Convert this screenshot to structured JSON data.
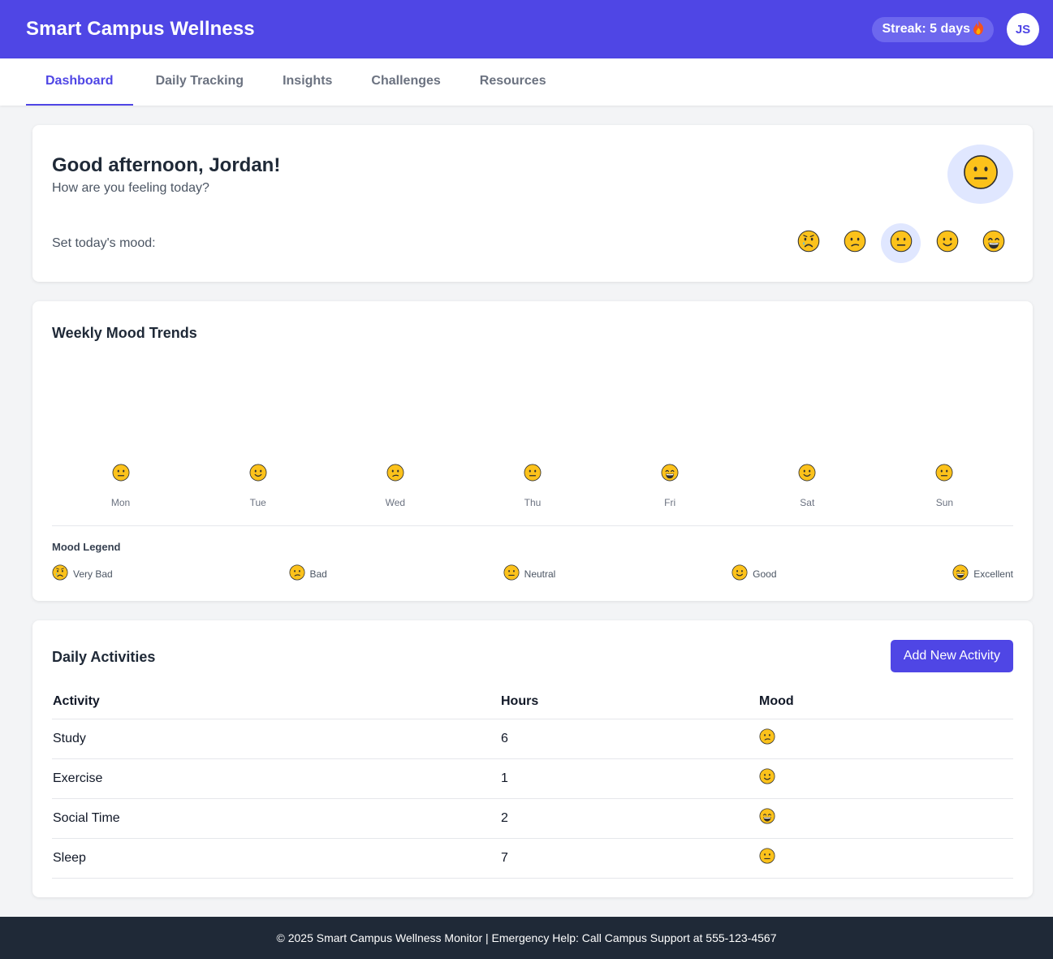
{
  "header": {
    "title": "Smart Campus Wellness",
    "streak_label": "Streak: 5 days",
    "streak_icon": "fire-icon",
    "avatar_initials": "JS"
  },
  "nav": {
    "tabs": [
      {
        "label": "Dashboard",
        "active": true
      },
      {
        "label": "Daily Tracking",
        "active": false
      },
      {
        "label": "Insights",
        "active": false
      },
      {
        "label": "Challenges",
        "active": false
      },
      {
        "label": "Resources",
        "active": false
      }
    ]
  },
  "greeting": {
    "heading": "Good afternoon, Jordan!",
    "subtitle": "How are you feeling today?",
    "current_mood": "neutral",
    "set_mood_label": "Set today's mood:",
    "mood_options": [
      "very-bad",
      "bad",
      "neutral",
      "good",
      "excellent"
    ],
    "selected_mood": "neutral"
  },
  "weekly": {
    "title": "Weekly Mood Trends",
    "days": [
      {
        "label": "Mon",
        "mood": "neutral"
      },
      {
        "label": "Tue",
        "mood": "good"
      },
      {
        "label": "Wed",
        "mood": "bad"
      },
      {
        "label": "Thu",
        "mood": "neutral"
      },
      {
        "label": "Fri",
        "mood": "excellent"
      },
      {
        "label": "Sat",
        "mood": "good"
      },
      {
        "label": "Sun",
        "mood": "neutral"
      }
    ],
    "legend_title": "Mood Legend",
    "legend": [
      {
        "mood": "very-bad",
        "label": "Very Bad"
      },
      {
        "mood": "bad",
        "label": "Bad"
      },
      {
        "mood": "neutral",
        "label": "Neutral"
      },
      {
        "mood": "good",
        "label": "Good"
      },
      {
        "mood": "excellent",
        "label": "Excellent"
      }
    ]
  },
  "activities": {
    "title": "Daily Activities",
    "add_button": "Add New Activity",
    "columns": [
      "Activity",
      "Hours",
      "Mood"
    ],
    "rows": [
      {
        "activity": "Study",
        "hours": "6",
        "mood": "bad"
      },
      {
        "activity": "Exercise",
        "hours": "1",
        "mood": "good"
      },
      {
        "activity": "Social Time",
        "hours": "2",
        "mood": "excellent"
      },
      {
        "activity": "Sleep",
        "hours": "7",
        "mood": "neutral"
      }
    ]
  },
  "footer": {
    "text": "© 2025 Smart Campus Wellness Monitor | Emergency Help: Call Campus Support at 555-123-4567"
  },
  "colors": {
    "brand": "#4f46e5",
    "brand_light": "#e0e7ff",
    "footer_bg": "#1f2937",
    "face_fill": "#fcc21b",
    "face_stroke": "#2f2f2f"
  }
}
